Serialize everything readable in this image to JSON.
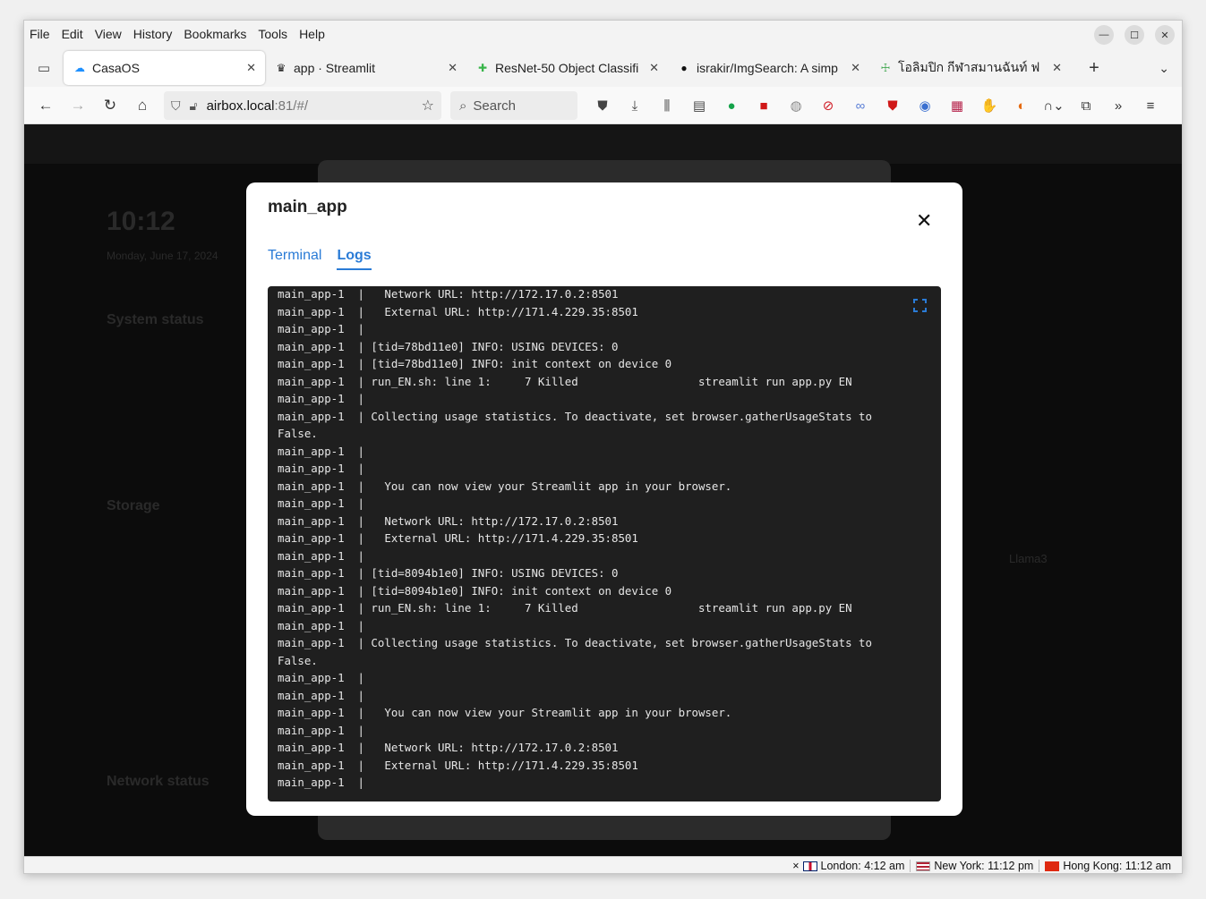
{
  "menubar": {
    "items": [
      "File",
      "Edit",
      "View",
      "History",
      "Bookmarks",
      "Tools",
      "Help"
    ]
  },
  "tabs": [
    {
      "label": "CasaOS",
      "active": true,
      "icon": "casaos-icon"
    },
    {
      "label": "app · Streamlit",
      "active": false,
      "icon": "streamlit-icon"
    },
    {
      "label": "ResNet-50 Object Classifi",
      "active": false,
      "icon": "resnet-icon"
    },
    {
      "label": "israkir/ImgSearch: A simp",
      "active": false,
      "icon": "github-icon"
    },
    {
      "label": "โอลิมปิก กีฬาสมานฉันท์ ฟ",
      "active": false,
      "icon": "olympic-icon"
    }
  ],
  "url": {
    "host": "airbox.local",
    "rest": ":81/#/"
  },
  "search": {
    "placeholder": "Search"
  },
  "modal": {
    "title": "main_app",
    "tabs": [
      {
        "label": "Terminal",
        "active": false
      },
      {
        "label": "Logs",
        "active": true
      }
    ]
  },
  "logs": [
    "main_app-1  |   Network URL: http://172.17.0.2:8501",
    "main_app-1  |   External URL: http://171.4.229.35:8501",
    "main_app-1  |",
    "main_app-1  | [tid=78bd11e0] INFO: USING DEVICES: 0",
    "main_app-1  | [tid=78bd11e0] INFO: init context on device 0",
    "main_app-1  | run_EN.sh: line 1:     7 Killed                  streamlit run app.py EN",
    "main_app-1  |",
    "main_app-1  | Collecting usage statistics. To deactivate, set browser.gatherUsageStats to",
    "False.",
    "main_app-1  |",
    "main_app-1  |",
    "main_app-1  |   You can now view your Streamlit app in your browser.",
    "main_app-1  |",
    "main_app-1  |   Network URL: http://172.17.0.2:8501",
    "main_app-1  |   External URL: http://171.4.229.35:8501",
    "main_app-1  |",
    "main_app-1  | [tid=8094b1e0] INFO: USING DEVICES: 0",
    "main_app-1  | [tid=8094b1e0] INFO: init context on device 0",
    "main_app-1  | run_EN.sh: line 1:     7 Killed                  streamlit run app.py EN",
    "main_app-1  |",
    "main_app-1  | Collecting usage statistics. To deactivate, set browser.gatherUsageStats to",
    "False.",
    "main_app-1  |",
    "main_app-1  |",
    "main_app-1  |   You can now view your Streamlit app in your browser.",
    "main_app-1  |",
    "main_app-1  |   Network URL: http://172.17.0.2:8501",
    "main_app-1  |   External URL: http://171.4.229.35:8501",
    "main_app-1  |"
  ],
  "background": {
    "time": "10:12",
    "date": "Monday, June 17, 2024",
    "system_status": "System status",
    "storage": "Storage",
    "network_status": "Network status",
    "app_name": "Llama3"
  },
  "clocks": [
    {
      "label": "London: 4:12 am",
      "flag": "uk"
    },
    {
      "label": "New York: 11:12 pm",
      "flag": "us"
    },
    {
      "label": "Hong Kong: 11:12 am",
      "flag": "hk"
    }
  ],
  "colors": {
    "accent": "#2a7bd6",
    "terminal_bg": "#1f1f1f",
    "terminal_fg": "#e6e6e6"
  }
}
